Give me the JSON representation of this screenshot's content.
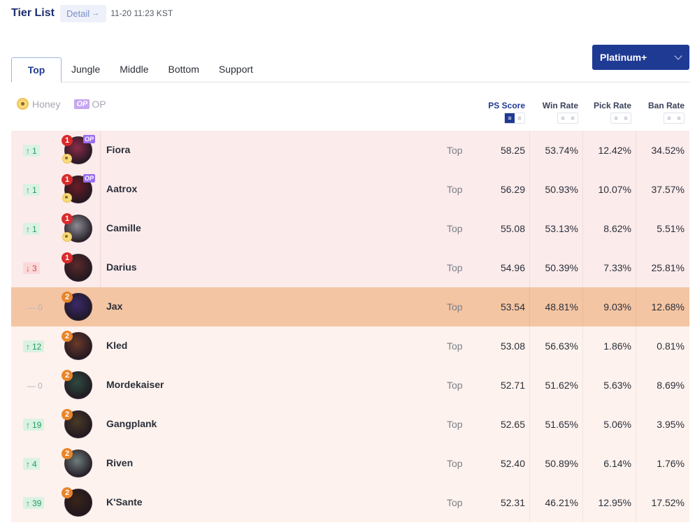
{
  "header": {
    "title": "Tier List",
    "detail_label": "Detail",
    "detail_arrow": "→",
    "timestamp": "11-20 11:23 KST"
  },
  "rank_select": {
    "value": "Platinum+"
  },
  "tabs": [
    {
      "label": "Top",
      "active": true
    },
    {
      "label": "Jungle",
      "active": false
    },
    {
      "label": "Middle",
      "active": false
    },
    {
      "label": "Bottom",
      "active": false
    },
    {
      "label": "Support",
      "active": false
    }
  ],
  "legend": {
    "honey_label": "Honey",
    "op_badge": "OP",
    "op_label": "OP"
  },
  "columns": {
    "ps_score": "PS Score",
    "win_rate": "Win Rate",
    "pick_rate": "Pick Rate",
    "ban_rate": "Ban Rate"
  },
  "colors": {
    "primary": "#1f3a93",
    "tier1_row": "#fbebeb",
    "tier2_row": "#fdf2ed",
    "highlight_row": "#f4c5a3",
    "rank_up": "#2a9a5b",
    "rank_down": "#d04a4a"
  },
  "rows": [
    {
      "change_dir": "up",
      "change_arrow": "↑",
      "change": "1",
      "tier": "1",
      "honey": true,
      "op": true,
      "op_label": "OP",
      "name": "Fiora",
      "role": "Top",
      "ps": "58.25",
      "win": "53.74%",
      "pick": "12.42%",
      "ban": "34.52%",
      "portrait_color": "#8b2d4a"
    },
    {
      "change_dir": "up",
      "change_arrow": "↑",
      "change": "1",
      "tier": "1",
      "honey": true,
      "op": true,
      "op_label": "OP",
      "name": "Aatrox",
      "role": "Top",
      "ps": "56.29",
      "win": "50.93%",
      "pick": "10.07%",
      "ban": "37.57%",
      "portrait_color": "#6a1d25"
    },
    {
      "change_dir": "up",
      "change_arrow": "↑",
      "change": "1",
      "tier": "1",
      "honey": true,
      "op": false,
      "name": "Camille",
      "role": "Top",
      "ps": "55.08",
      "win": "53.13%",
      "pick": "8.62%",
      "ban": "5.51%",
      "portrait_color": "#8d8c92"
    },
    {
      "change_dir": "down",
      "change_arrow": "↓",
      "change": "3",
      "tier": "1",
      "honey": false,
      "op": false,
      "name": "Darius",
      "role": "Top",
      "ps": "54.96",
      "win": "50.39%",
      "pick": "7.33%",
      "ban": "25.81%",
      "portrait_color": "#5a2a2a"
    },
    {
      "change_dir": "same",
      "change_arrow": "—",
      "change": "0",
      "tier": "2",
      "honey": false,
      "op": false,
      "name": "Jax",
      "role": "Top",
      "ps": "53.54",
      "win": "48.81%",
      "pick": "9.03%",
      "ban": "12.68%",
      "portrait_color": "#3a2a6a",
      "highlight": true
    },
    {
      "change_dir": "up",
      "change_arrow": "↑",
      "change": "12",
      "tier": "2",
      "honey": false,
      "op": false,
      "name": "Kled",
      "role": "Top",
      "ps": "53.08",
      "win": "56.63%",
      "pick": "1.86%",
      "ban": "0.81%",
      "portrait_color": "#6b3a2a"
    },
    {
      "change_dir": "same",
      "change_arrow": "—",
      "change": "0",
      "tier": "2",
      "honey": false,
      "op": false,
      "name": "Mordekaiser",
      "role": "Top",
      "ps": "52.71",
      "win": "51.62%",
      "pick": "5.63%",
      "ban": "8.69%",
      "portrait_color": "#2f4a3f"
    },
    {
      "change_dir": "up",
      "change_arrow": "↑",
      "change": "19",
      "tier": "2",
      "honey": false,
      "op": false,
      "name": "Gangplank",
      "role": "Top",
      "ps": "52.65",
      "win": "51.65%",
      "pick": "5.06%",
      "ban": "3.95%",
      "portrait_color": "#4a3a25"
    },
    {
      "change_dir": "up",
      "change_arrow": "↑",
      "change": "4",
      "tier": "2",
      "honey": false,
      "op": false,
      "name": "Riven",
      "role": "Top",
      "ps": "52.40",
      "win": "50.89%",
      "pick": "6.14%",
      "ban": "1.76%",
      "portrait_color": "#6f7d7a"
    },
    {
      "change_dir": "up",
      "change_arrow": "↑",
      "change": "39",
      "tier": "2",
      "honey": false,
      "op": false,
      "name": "K'Sante",
      "role": "Top",
      "ps": "52.31",
      "win": "46.21%",
      "pick": "12.95%",
      "ban": "17.52%",
      "portrait_color": "#3a2418"
    }
  ]
}
